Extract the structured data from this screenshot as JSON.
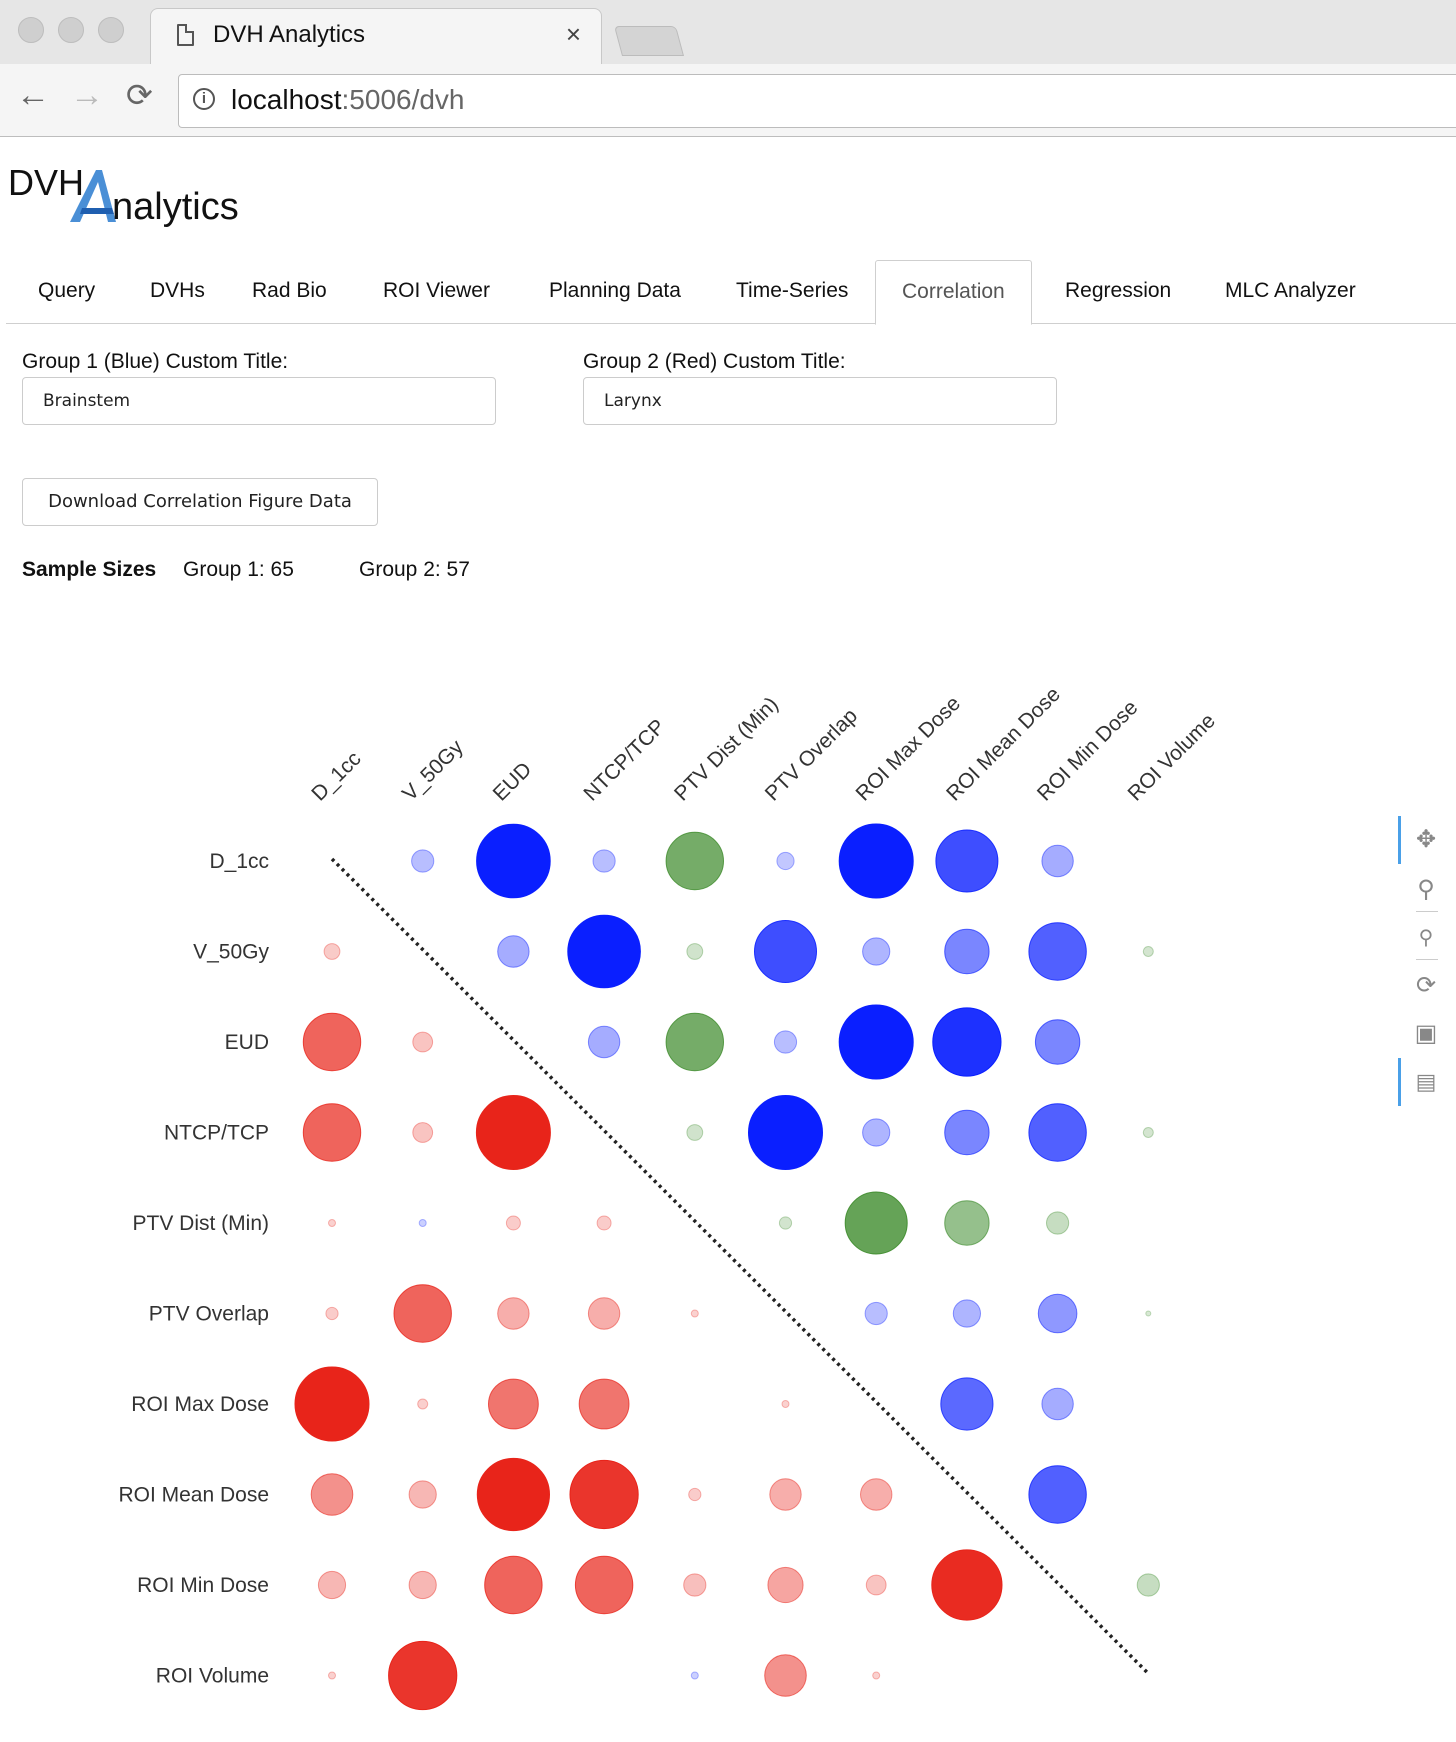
{
  "browser": {
    "tab_title": "DVH Analytics",
    "tab_close": "×",
    "url_host": "localhost",
    "url_rest": ":5006/dvh"
  },
  "logo": {
    "part1": "DVH",
    "part2": "nalytics"
  },
  "tabs": [
    "Query",
    "DVHs",
    "Rad Bio",
    "ROI Viewer",
    "Planning Data",
    "Time-Series",
    "Correlation",
    "Regression",
    "MLC Analyzer"
  ],
  "active_tab": "Correlation",
  "group1": {
    "label": "Group 1 (Blue) Custom Title:",
    "value": "Brainstem"
  },
  "group2": {
    "label": "Group 2 (Red) Custom Title:",
    "value": "Larynx"
  },
  "download_button": "Download Correlation Figure Data",
  "sample_sizes": {
    "title": "Sample Sizes",
    "group1": "Group 1: 65",
    "group2": "Group 2: 57"
  },
  "colors": {
    "group1": "#0a1fff",
    "group2": "#e8241a",
    "nonsignificant": "#3c8a2a",
    "diagonal": "#222222"
  },
  "tool_icons": [
    "pan-icon",
    "box-zoom-icon",
    "wheel-zoom-icon",
    "reset-icon",
    "save-icon",
    "hover-icon"
  ],
  "chart_data": {
    "type": "scatter",
    "variables": [
      "D_1cc",
      "V_50Gy",
      "EUD",
      "NTCP/TCP",
      "PTV Dist (Min)",
      "PTV Overlap",
      "ROI Max Dose",
      "ROI Mean Dose",
      "ROI Min Dose",
      "ROI Volume"
    ],
    "note": "Correlation matrix: upper triangle Group 1 (blue), lower triangle Group 2 (red); green = not significant. Marker size ~ |r|, opacity ~ |r|.",
    "cells": [
      {
        "row": 0,
        "col": 2,
        "r": 0.1,
        "c": "b"
      },
      {
        "row": 0,
        "col": 3,
        "r": 0.99,
        "c": "b"
      },
      {
        "row": 0,
        "col": 4,
        "r": 0.1,
        "c": "b"
      },
      {
        "row": 0,
        "col": 5,
        "r": 0.6,
        "c": "g"
      },
      {
        "row": 0,
        "col": 6,
        "r": 0.06,
        "c": "b"
      },
      {
        "row": 0,
        "col": 7,
        "r": 1.0,
        "c": "b"
      },
      {
        "row": 0,
        "col": 8,
        "r": 0.7,
        "c": "b"
      },
      {
        "row": 0,
        "col": 9,
        "r": 0.2,
        "c": "b"
      },
      {
        "row": 1,
        "col": 1,
        "r": 0.05,
        "c": "r"
      },
      {
        "row": 1,
        "col": 3,
        "r": 0.2,
        "c": "b"
      },
      {
        "row": 1,
        "col": 4,
        "r": 0.96,
        "c": "b"
      },
      {
        "row": 1,
        "col": 5,
        "r": 0.05,
        "c": "g"
      },
      {
        "row": 1,
        "col": 6,
        "r": 0.7,
        "c": "b"
      },
      {
        "row": 1,
        "col": 7,
        "r": 0.15,
        "c": "b"
      },
      {
        "row": 1,
        "col": 8,
        "r": 0.4,
        "c": "b"
      },
      {
        "row": 1,
        "col": 9,
        "r": 0.6,
        "c": "b"
      },
      {
        "row": 1,
        "col": 10,
        "r": 0.02,
        "c": "g"
      },
      {
        "row": 2,
        "col": 1,
        "r": 0.6,
        "c": "r"
      },
      {
        "row": 2,
        "col": 2,
        "r": 0.08,
        "c": "r"
      },
      {
        "row": 2,
        "col": 4,
        "r": 0.2,
        "c": "b"
      },
      {
        "row": 2,
        "col": 5,
        "r": 0.6,
        "c": "g"
      },
      {
        "row": 2,
        "col": 6,
        "r": 0.1,
        "c": "b"
      },
      {
        "row": 2,
        "col": 7,
        "r": 1.0,
        "c": "b"
      },
      {
        "row": 2,
        "col": 8,
        "r": 0.85,
        "c": "b"
      },
      {
        "row": 2,
        "col": 9,
        "r": 0.4,
        "c": "b"
      },
      {
        "row": 3,
        "col": 1,
        "r": 0.6,
        "c": "r"
      },
      {
        "row": 3,
        "col": 2,
        "r": 0.08,
        "c": "r"
      },
      {
        "row": 3,
        "col": 3,
        "r": 1.0,
        "c": "r"
      },
      {
        "row": 3,
        "col": 5,
        "r": 0.05,
        "c": "g"
      },
      {
        "row": 3,
        "col": 6,
        "r": 1.0,
        "c": "b"
      },
      {
        "row": 3,
        "col": 7,
        "r": 0.15,
        "c": "b"
      },
      {
        "row": 3,
        "col": 8,
        "r": 0.4,
        "c": "b"
      },
      {
        "row": 3,
        "col": 9,
        "r": 0.6,
        "c": "b"
      },
      {
        "row": 3,
        "col": 10,
        "r": 0.02,
        "c": "g"
      },
      {
        "row": 4,
        "col": 1,
        "r": 0.01,
        "c": "r"
      },
      {
        "row": 4,
        "col": 2,
        "r": 0.01,
        "c": "b"
      },
      {
        "row": 4,
        "col": 3,
        "r": 0.04,
        "c": "r"
      },
      {
        "row": 4,
        "col": 4,
        "r": 0.04,
        "c": "r"
      },
      {
        "row": 4,
        "col": 6,
        "r": 0.03,
        "c": "g"
      },
      {
        "row": 4,
        "col": 7,
        "r": 0.7,
        "c": "g"
      },
      {
        "row": 4,
        "col": 8,
        "r": 0.4,
        "c": "g"
      },
      {
        "row": 4,
        "col": 9,
        "r": 0.1,
        "c": "g"
      },
      {
        "row": 5,
        "col": 1,
        "r": 0.03,
        "c": "r"
      },
      {
        "row": 5,
        "col": 2,
        "r": 0.6,
        "c": "r"
      },
      {
        "row": 5,
        "col": 3,
        "r": 0.2,
        "c": "r"
      },
      {
        "row": 5,
        "col": 4,
        "r": 0.2,
        "c": "r"
      },
      {
        "row": 5,
        "col": 5,
        "r": 0.01,
        "c": "r"
      },
      {
        "row": 5,
        "col": 7,
        "r": 0.1,
        "c": "b"
      },
      {
        "row": 5,
        "col": 8,
        "r": 0.15,
        "c": "b"
      },
      {
        "row": 5,
        "col": 9,
        "r": 0.3,
        "c": "b"
      },
      {
        "row": 5,
        "col": 10,
        "r": 0.005,
        "c": "g"
      },
      {
        "row": 6,
        "col": 1,
        "r": 1.0,
        "c": "r"
      },
      {
        "row": 6,
        "col": 2,
        "r": 0.02,
        "c": "r"
      },
      {
        "row": 6,
        "col": 3,
        "r": 0.5,
        "c": "r"
      },
      {
        "row": 6,
        "col": 4,
        "r": 0.5,
        "c": "r"
      },
      {
        "row": 6,
        "col": 6,
        "r": 0.01,
        "c": "r"
      },
      {
        "row": 6,
        "col": 8,
        "r": 0.55,
        "c": "b"
      },
      {
        "row": 6,
        "col": 9,
        "r": 0.2,
        "c": "b"
      },
      {
        "row": 7,
        "col": 1,
        "r": 0.35,
        "c": "r"
      },
      {
        "row": 7,
        "col": 2,
        "r": 0.15,
        "c": "r"
      },
      {
        "row": 7,
        "col": 3,
        "r": 0.95,
        "c": "r"
      },
      {
        "row": 7,
        "col": 4,
        "r": 0.85,
        "c": "r"
      },
      {
        "row": 7,
        "col": 5,
        "r": 0.03,
        "c": "r"
      },
      {
        "row": 7,
        "col": 6,
        "r": 0.2,
        "c": "r"
      },
      {
        "row": 7,
        "col": 7,
        "r": 0.2,
        "c": "r"
      },
      {
        "row": 7,
        "col": 9,
        "r": 0.6,
        "c": "b"
      },
      {
        "row": 8,
        "col": 1,
        "r": 0.15,
        "c": "r"
      },
      {
        "row": 8,
        "col": 2,
        "r": 0.15,
        "c": "r"
      },
      {
        "row": 8,
        "col": 3,
        "r": 0.6,
        "c": "r"
      },
      {
        "row": 8,
        "col": 4,
        "r": 0.6,
        "c": "r"
      },
      {
        "row": 8,
        "col": 5,
        "r": 0.1,
        "c": "r"
      },
      {
        "row": 8,
        "col": 6,
        "r": 0.25,
        "c": "r"
      },
      {
        "row": 8,
        "col": 7,
        "r": 0.08,
        "c": "r"
      },
      {
        "row": 8,
        "col": 8,
        "r": 0.9,
        "c": "r"
      },
      {
        "row": 8,
        "col": 10,
        "r": 0.1,
        "c": "g"
      },
      {
        "row": 9,
        "col": 1,
        "r": 0.01,
        "c": "r"
      },
      {
        "row": 9,
        "col": 2,
        "r": 0.85,
        "c": "r"
      },
      {
        "row": 9,
        "col": 5,
        "r": 0.01,
        "c": "b"
      },
      {
        "row": 9,
        "col": 6,
        "r": 0.35,
        "c": "r"
      },
      {
        "row": 9,
        "col": 7,
        "r": 0.01,
        "c": "r"
      }
    ]
  }
}
